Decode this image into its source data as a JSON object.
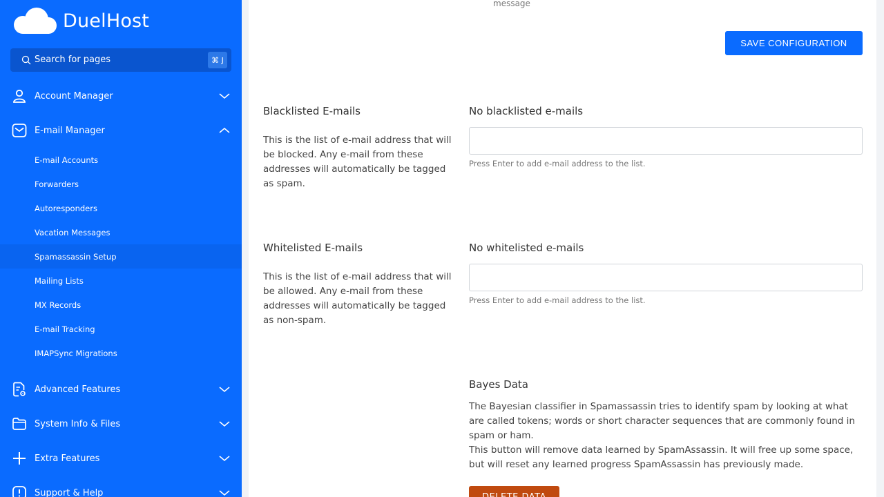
{
  "brand": {
    "name": "DuelHost"
  },
  "search": {
    "placeholder": "Search for pages",
    "shortcut": "⌘ J"
  },
  "sidebar": {
    "account_manager": "Account Manager",
    "email_manager": "E-mail Manager",
    "email_sub": [
      "E-mail Accounts",
      "Forwarders",
      "Autoresponders",
      "Vacation Messages",
      "Spamassassin Setup",
      "Mailing Lists",
      "MX Records",
      "E-mail Tracking",
      "IMAPSync Migrations"
    ],
    "active_sub": "Spamassassin Setup",
    "advanced_features": "Advanced Features",
    "system_info": "System Info & Files",
    "extra_features": "Extra Features",
    "support_help": "Support & Help"
  },
  "main": {
    "top_message": "message",
    "save_button": "SAVE CONFIGURATION",
    "blacklist": {
      "title": "Blacklisted E-mails",
      "description": "This is the list of e-mail address that will be blocked. Any e-mail from these addresses will automatically be tagged as spam.",
      "field_title": "No blacklisted e-mails",
      "help": "Press Enter to add e-mail address to the list."
    },
    "whitelist": {
      "title": "Whitelisted E-mails",
      "description": "This is the list of e-mail address that will be allowed. Any e-mail from these addresses will automatically be tagged as non-spam.",
      "field_title": "No whitelisted e-mails",
      "help": "Press Enter to add e-mail address to the list."
    },
    "bayes": {
      "title": "Bayes Data",
      "paragraph1": "The Bayesian classifier in Spamassassin tries to identify spam by looking at what are called tokens; words or short character sequences that are commonly found in spam or ham.",
      "paragraph2": "This button will remove data learned by SpamAssassin. It will free up some space, but will reset any learned progress SpamAssassin has previously made.",
      "delete_button": "DELETE DATA"
    }
  },
  "colors": {
    "primary": "#0a6bff",
    "danger": "#c04a0f"
  }
}
